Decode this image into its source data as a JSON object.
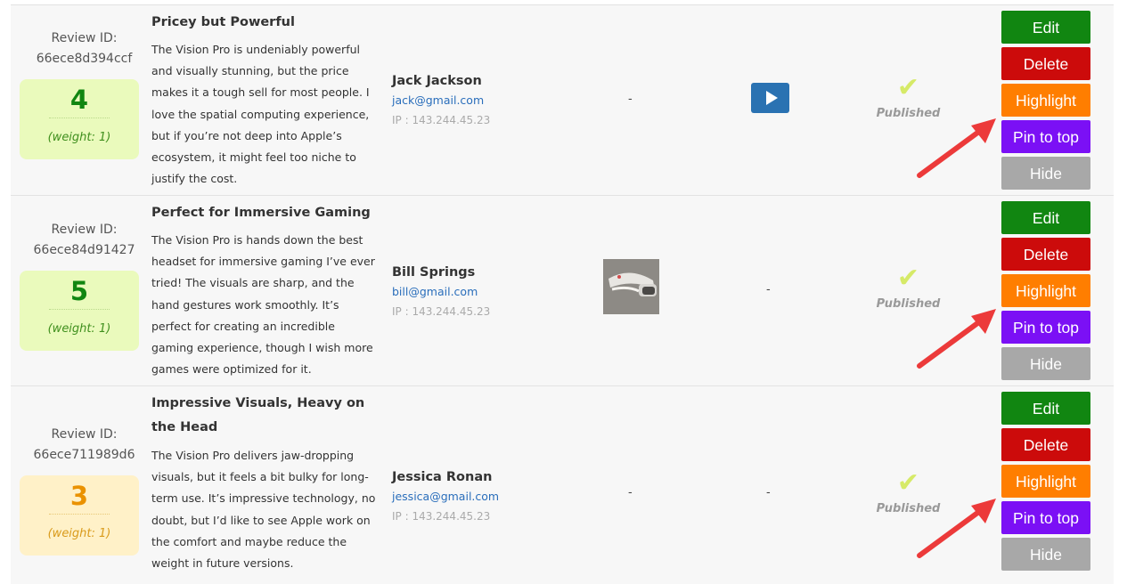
{
  "review_id_label": "Review ID:",
  "status_check": "✔",
  "buttons": {
    "edit": "Edit",
    "delete": "Delete",
    "highlight": "Highlight",
    "pin": "Pin to top",
    "hide": "Hide"
  },
  "colors": {
    "green_score": "#118611",
    "orange_score": "#ea9200",
    "arrow": "#ec3a3a"
  },
  "reviews": [
    {
      "id": "66ece8d394ccf",
      "score": "4",
      "weight": "(weight: 1)",
      "title": "Pricey but Powerful",
      "body": "The Vision Pro is undeniably powerful and visually stunning, but the price makes it a tough sell for most people. I love the spatial computing experience, but if you’re not deep into Apple’s ecosystem, it might feel too niche to justify the cost.",
      "name": "Jack Jackson",
      "email": "jack@gmail.com",
      "ip": "IP : 143.244.45.23",
      "image": "-",
      "status": "Published"
    },
    {
      "id": "66ece84d91427",
      "score": "5",
      "weight": "(weight: 1)",
      "title": "Perfect for Immersive Gaming",
      "body": "The Vision Pro is hands down the best headset for immersive gaming I’ve ever tried! The visuals are sharp, and the hand gestures work smoothly. It’s perfect for creating an incredible gaming experience, though I wish more games were optimized for it.",
      "name": "Bill Springs",
      "email": "bill@gmail.com",
      "ip": "IP : 143.244.45.23",
      "video": "-",
      "status": "Published"
    },
    {
      "id": "66ece711989d6",
      "score": "3",
      "weight": "(weight: 1)",
      "title": "Impressive Visuals, Heavy on the Head",
      "body": "The Vision Pro delivers jaw-dropping visuals, but it feels a bit bulky for long-term use. It’s impressive technology, no doubt, but I’d like to see Apple work on the comfort and maybe reduce the weight in future versions.",
      "name": "Jessica Ronan",
      "email": "jessica@gmail.com",
      "ip": "IP : 143.244.45.23",
      "image": "-",
      "video": "-",
      "status": "Published"
    }
  ]
}
